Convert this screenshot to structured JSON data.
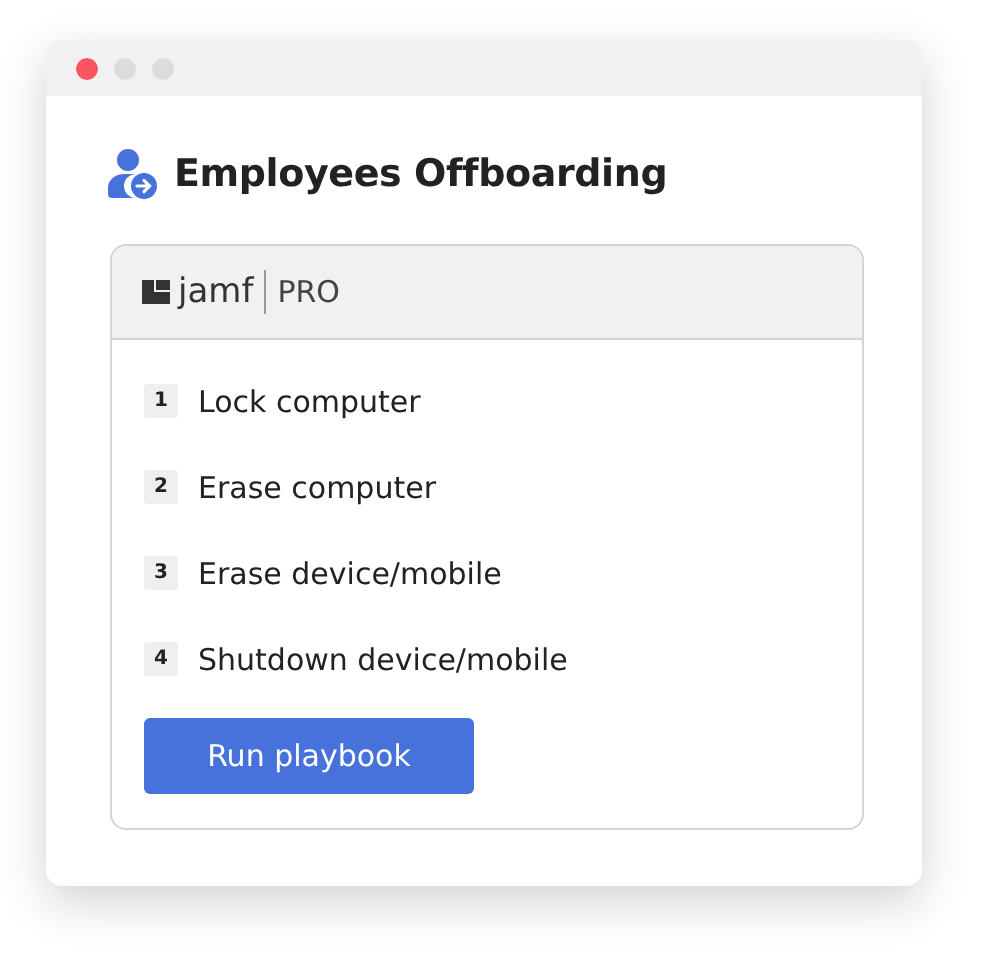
{
  "window": {
    "title": "Employees Offboarding"
  },
  "integration": {
    "brand": "jamf",
    "product": "PRO"
  },
  "steps": [
    {
      "number": "1",
      "label": "Lock computer"
    },
    {
      "number": "2",
      "label": "Erase computer"
    },
    {
      "number": "3",
      "label": "Erase device/mobile"
    },
    {
      "number": "4",
      "label": "Shutdown device/mobile"
    }
  ],
  "button": {
    "label": "Run playbook"
  }
}
